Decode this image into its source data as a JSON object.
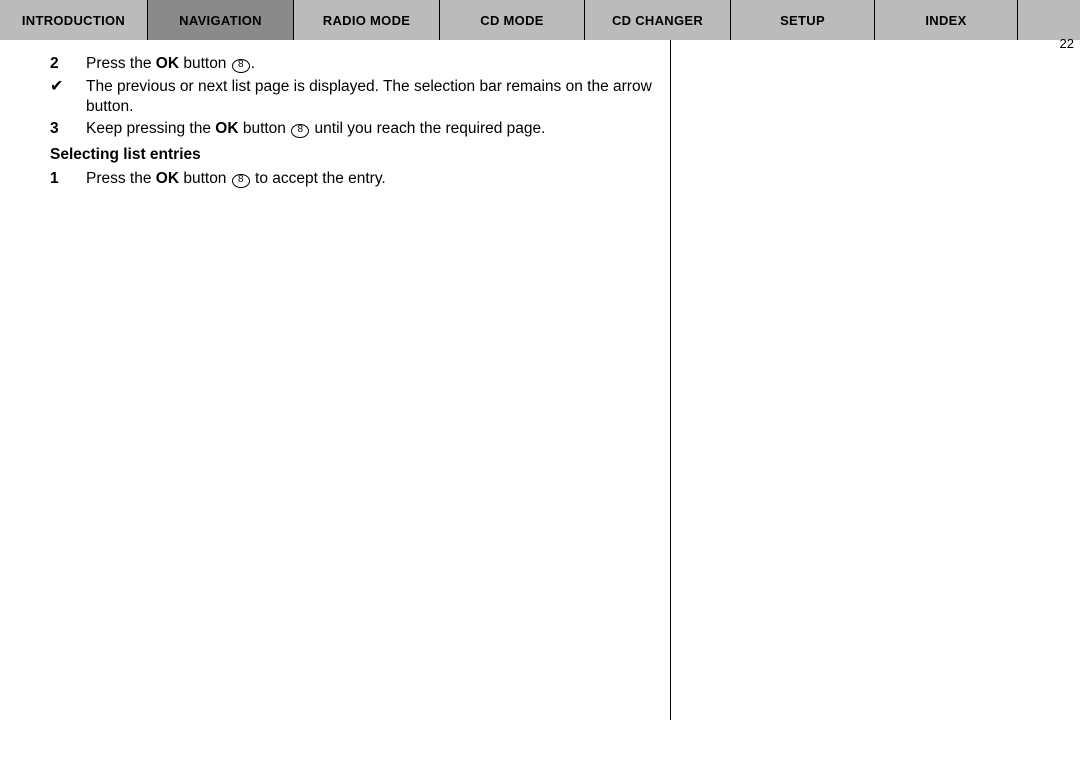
{
  "page_number": "22",
  "tabs": [
    {
      "id": "introduction",
      "label": "Introduction",
      "active": false
    },
    {
      "id": "navigation",
      "label": "Navigation",
      "active": true
    },
    {
      "id": "radio-mode",
      "label": "Radio Mode",
      "active": false
    },
    {
      "id": "cd-mode",
      "label": "Cd Mode",
      "active": false
    },
    {
      "id": "cd-changer",
      "label": "Cd Changer",
      "active": false
    },
    {
      "id": "setup",
      "label": "Setup",
      "active": false
    },
    {
      "id": "index",
      "label": "Index",
      "active": false
    }
  ],
  "steps_a": [
    {
      "marker": "2",
      "marker_type": "num",
      "pre": "Press the ",
      "bold": "OK",
      "mid": " button ",
      "btn": "8",
      "post": "."
    },
    {
      "marker": "✔",
      "marker_type": "check",
      "plain": "The previous or next list page is displayed. The selection bar remains on the arrow button."
    },
    {
      "marker": "3",
      "marker_type": "num",
      "pre": "Keep pressing the ",
      "bold": "OK",
      "mid": " button ",
      "btn": "8",
      "post": " until you reach the required page."
    }
  ],
  "subheading": "Selecting list entries",
  "steps_b": [
    {
      "marker": "1",
      "marker_type": "num",
      "pre": "Press the ",
      "bold": "OK",
      "mid": " button ",
      "btn": "8",
      "post": " to accept the entry."
    }
  ]
}
